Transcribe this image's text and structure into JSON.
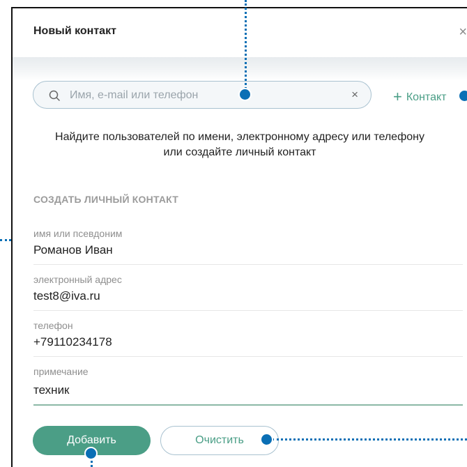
{
  "dialog": {
    "title": "Новый контакт",
    "close_symbol": "×"
  },
  "search": {
    "placeholder": "Имя, e-mail или телефон",
    "value": "",
    "clear_symbol": "×",
    "icon": "search-icon"
  },
  "add_contact": {
    "plus": "+",
    "label": "Контакт"
  },
  "hint": {
    "line1": "Найдите пользователей по имени, электронному адресу или телефону",
    "line2": "или создайте личный контакт"
  },
  "section": {
    "title": "СОЗДАТЬ ЛИЧНЫЙ КОНТАКТ"
  },
  "fields": {
    "name": {
      "label": "имя или псевдоним",
      "value": "Романов Иван"
    },
    "email": {
      "label": "электронный адрес",
      "value": "test8@iva.ru"
    },
    "phone": {
      "label": "телефон",
      "value": "+79110234178"
    },
    "note": {
      "label": "примечание",
      "value": "техник"
    }
  },
  "buttons": {
    "add": "Добавить",
    "clear": "Очистить"
  },
  "colors": {
    "accent": "#4b9e86",
    "input_border": "#a9c2d0",
    "callout": "#0a6fb5"
  }
}
